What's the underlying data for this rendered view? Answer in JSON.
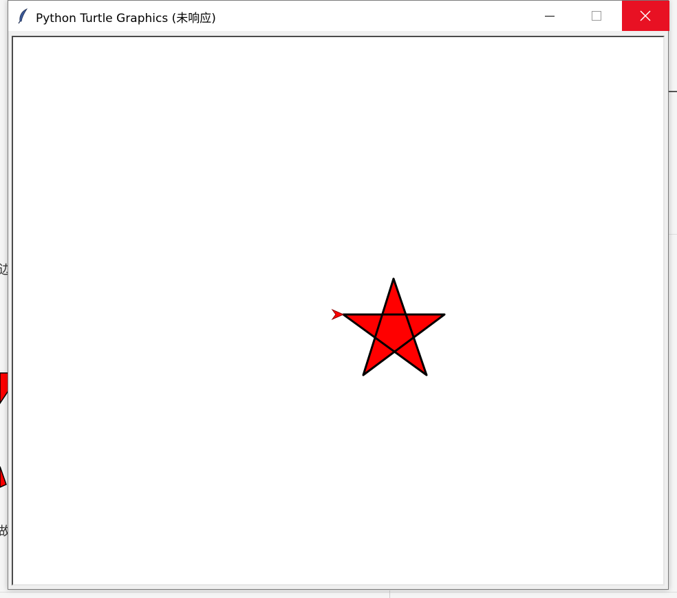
{
  "window": {
    "title": "Python Turtle Graphics (未响应)",
    "icon": "feather-icon",
    "controls": {
      "minimize": "minimize-icon",
      "maximize": "maximize-icon",
      "close": "close-icon"
    }
  },
  "background": {
    "partial_text_1": "边",
    "partial_text_2": "故"
  },
  "canvas": {
    "background_color": "#ffffff",
    "star": {
      "fill_color": "#ff0000",
      "stroke_color": "#000000"
    },
    "turtle_cursor": {
      "fill_color": "#ff0000"
    }
  },
  "colors": {
    "close_button": "#e81123",
    "titlebar": "#ffffff"
  }
}
